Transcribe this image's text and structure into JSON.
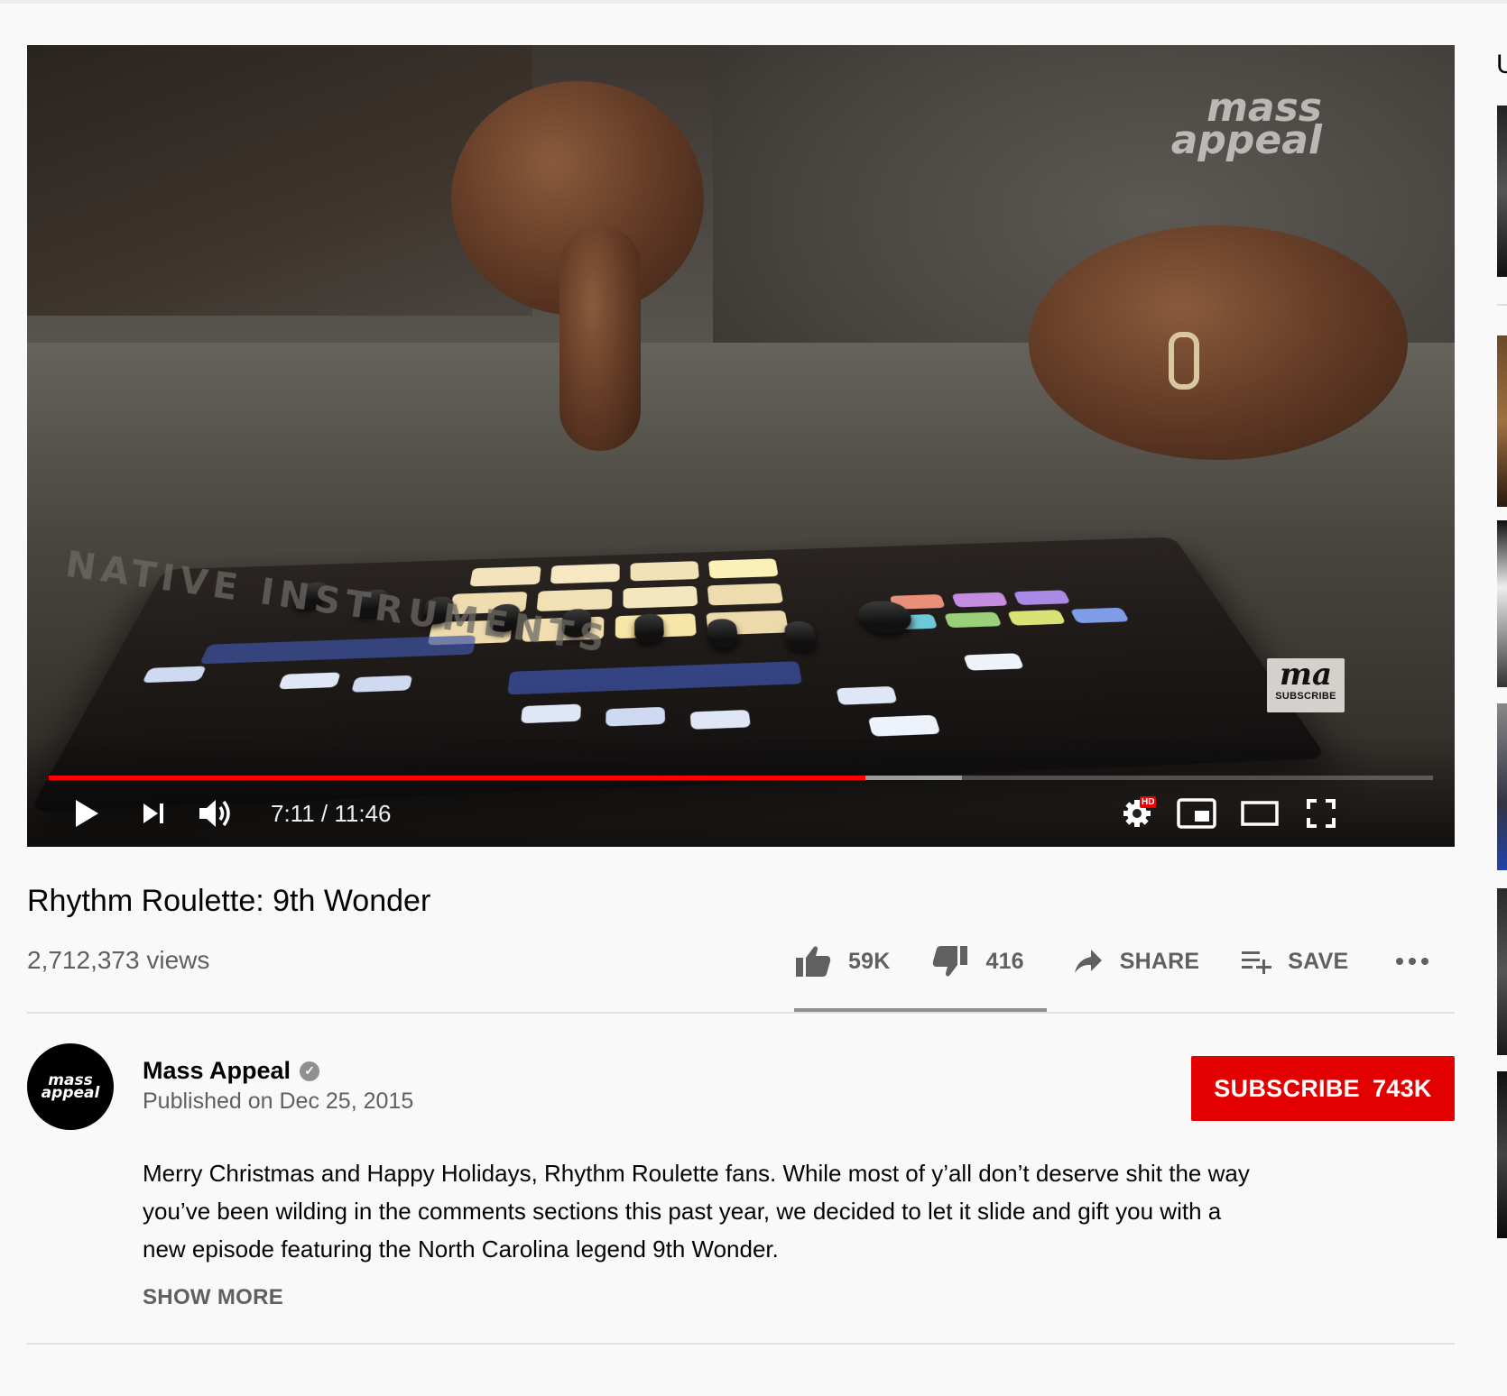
{
  "video": {
    "watermark": "mass appeal",
    "subscribe_badge": {
      "logo": "ma",
      "label": "SUBSCRIBE"
    },
    "hardware_brand": "NATIVE INSTRUMENTS",
    "time_display": "7:11 / 11:46",
    "current_time": "7:11",
    "duration": "11:46",
    "progress_fraction": 0.59,
    "buffered_fraction": 0.66,
    "hd_badge": "HD",
    "progress_color": "#ff0000"
  },
  "info": {
    "title": "Rhythm Roulette: 9th Wonder",
    "views": "2,712,373 views",
    "likes": "59K",
    "dislikes": "416",
    "share_label": "SHARE",
    "save_label": "SAVE",
    "like_fraction": 0.993
  },
  "channel": {
    "name": "Mass Appeal",
    "avatar_text": "mass appeal",
    "published": "Published on Dec 25, 2015",
    "subscribe_label": "SUBSCRIBE",
    "subscriber_count": "743K",
    "subscribe_color": "#e20000"
  },
  "description": {
    "text": "Merry Christmas and Happy Holidays, Rhythm Roulette fans. While most of y’all don’t deserve shit the way you’ve been wilding in the comments sections this past year, we decided to let it slide and gift you with a new episode featuring the North Carolina legend 9th Wonder.",
    "show_more": "SHOW MORE"
  },
  "sidebar": {
    "partial_heading": "U"
  },
  "icons": [
    "play-icon",
    "next-icon",
    "volume-icon",
    "settings-icon",
    "miniplayer-icon",
    "theater-icon",
    "fullscreen-icon",
    "thumbs-up-icon",
    "thumbs-down-icon",
    "share-icon",
    "playlist-add-icon",
    "more-icon",
    "verified-icon"
  ]
}
